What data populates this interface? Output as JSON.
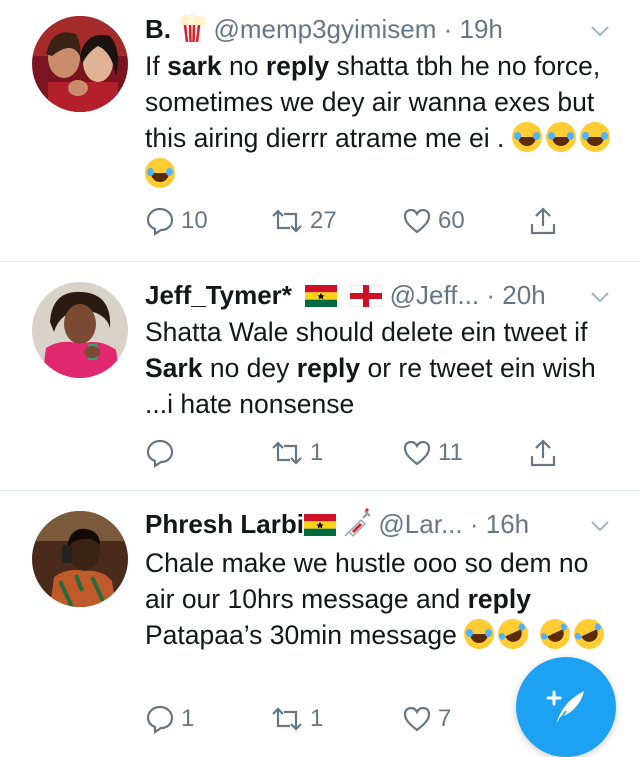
{
  "colors": {
    "accent": "#1da1f2",
    "secondary_text": "#657786",
    "divider": "#e1e8ed",
    "primary_text": "#14171a"
  },
  "tweets": [
    {
      "name": "B.",
      "name_icons": [
        "popcorn-icon"
      ],
      "handle": "@memp3gyimisem",
      "time": "19h",
      "text_segments": [
        {
          "t": "If ",
          "b": false
        },
        {
          "t": "sark",
          "b": true
        },
        {
          "t": " no ",
          "b": false
        },
        {
          "t": "reply",
          "b": true
        },
        {
          "t": " shatta tbh he no force, sometimes we dey air wanna exes but this airing dierrr atrame me ei .",
          "b": false
        }
      ],
      "emojis": [
        "face-with-tears-of-joy",
        "face-with-tears-of-joy",
        "face-with-tears-of-joy",
        "face-with-tears-of-joy"
      ],
      "replies": "10",
      "retweets": "27",
      "likes": "60"
    },
    {
      "name": "Jeff_Tymer*",
      "name_icons": [
        "ghana-flag-icon",
        "england-flag-icon"
      ],
      "handle": "@Jeff...",
      "time": "20h",
      "text_segments": [
        {
          "t": "Shatta Wale should delete ein tweet if ",
          "b": false
        },
        {
          "t": "Sark",
          "b": true
        },
        {
          "t": " no dey ",
          "b": false
        },
        {
          "t": "reply",
          "b": true
        },
        {
          "t": " or re tweet ein wish ...i hate nonsense",
          "b": false
        }
      ],
      "emojis": [],
      "replies": "",
      "retweets": "1",
      "likes": "11"
    },
    {
      "name": "Phresh Larbi",
      "name_icons": [
        "ghana-flag-icon",
        "syringe-icon"
      ],
      "handle": "@Lar...",
      "time": "16h",
      "text_segments": [
        {
          "t": "Chale make we hustle ooo so dem no air our 10hrs message and ",
          "b": false
        },
        {
          "t": "reply",
          "b": true
        },
        {
          "t": " Patapaa’s 30min message ",
          "b": false
        }
      ],
      "emojis": [
        "face-with-tears-of-joy",
        "rolling-on-floor-laughing",
        "rolling-on-floor-laughing",
        "rolling-on-floor-laughing"
      ],
      "replies": "1",
      "retweets": "1",
      "likes": "7"
    }
  ],
  "fab": {
    "icon": "compose-feather-icon"
  }
}
